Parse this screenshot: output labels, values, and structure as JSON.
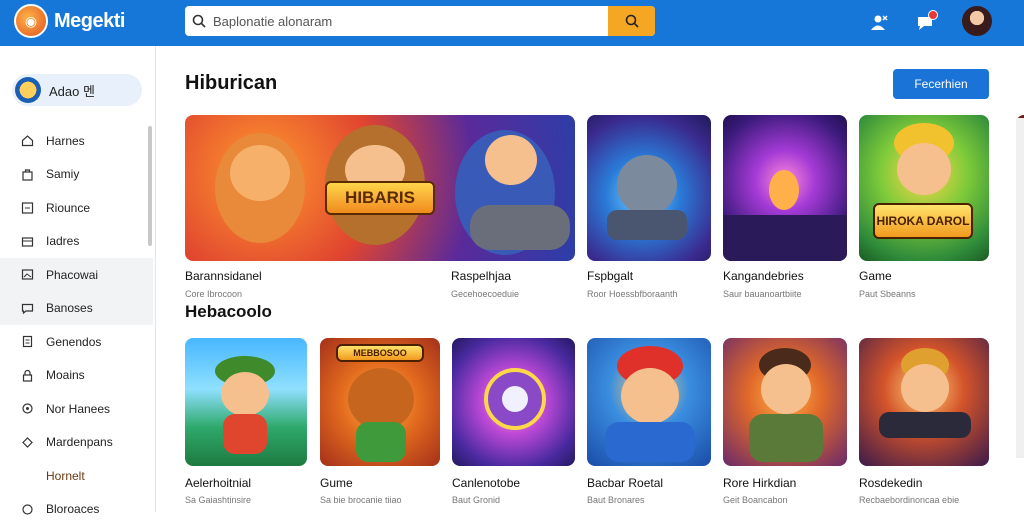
{
  "header": {
    "brand": "Megekti",
    "search_placeholder": "Baplonatie alonaram"
  },
  "sidebar": {
    "user": "Adao 멘",
    "items": [
      {
        "label": "Harnes",
        "icon": "home-icon"
      },
      {
        "label": "Samiy",
        "icon": "bag-icon"
      },
      {
        "label": "Riounce",
        "icon": "calendar-icon"
      },
      {
        "label": "Iadres",
        "icon": "card-icon"
      },
      {
        "label": "Phacowai",
        "icon": "picture-icon",
        "active": true
      },
      {
        "label": "Banoses",
        "icon": "chat-icon",
        "active": true
      },
      {
        "label": "Genendos",
        "icon": "doc-icon"
      },
      {
        "label": "Moains",
        "icon": "lock-icon"
      },
      {
        "label": "Nor Hanees",
        "icon": "location-icon"
      },
      {
        "label": "Mardenpans",
        "icon": "settings-icon"
      },
      {
        "label": "Hornelt",
        "icon": "",
        "indent": true
      },
      {
        "label": "Bloroaces",
        "icon": "info-icon"
      }
    ]
  },
  "main": {
    "section_title": "Hiburican",
    "action_button": "Fecerhien",
    "subsection_title": "Hebacoolo",
    "row1": [
      {
        "title": "Barannsidanel",
        "sub": "Core Ibrocoon",
        "thumb": "t-banner",
        "logo": "HIBARIS"
      },
      {
        "title": "Raspelhjaa",
        "sub": "Gecehoecoeduie",
        "thumb": "t-banner",
        "logo": ""
      },
      {
        "title": "Fspbgalt",
        "sub": "Roor Hoessbfboraanth",
        "thumb": "t-cannon",
        "logo": ""
      },
      {
        "title": "Kangandebries",
        "sub": "Saur bauanoartbiite",
        "thumb": "t-neon",
        "logo": ""
      },
      {
        "title": "Game",
        "sub": "Paut Sbeanns",
        "thumb": "t-hero",
        "logo": "HIROKA DAROL"
      }
    ],
    "row2": [
      {
        "title": "Aelerhoitnial",
        "sub": "Sa Gaiashtinsire",
        "thumb": "t-beach"
      },
      {
        "title": "Gume",
        "sub": "Sa bie brocanie tiiao",
        "thumb": "t-bear",
        "logo": "MEBBOSOO"
      },
      {
        "title": "Canlenotobe",
        "sub": "Baut Gronid",
        "thumb": "t-eye"
      },
      {
        "title": "Bacbar Roetal",
        "sub": "Baut Bronares",
        "thumb": "t-cap"
      },
      {
        "title": "Rore Hirkdian",
        "sub": "Geit Boancabon",
        "thumb": "t-camera"
      },
      {
        "title": "Rosdekedin",
        "sub": "Recbaebordinoncaa ebie",
        "thumb": "t-gun"
      }
    ]
  }
}
